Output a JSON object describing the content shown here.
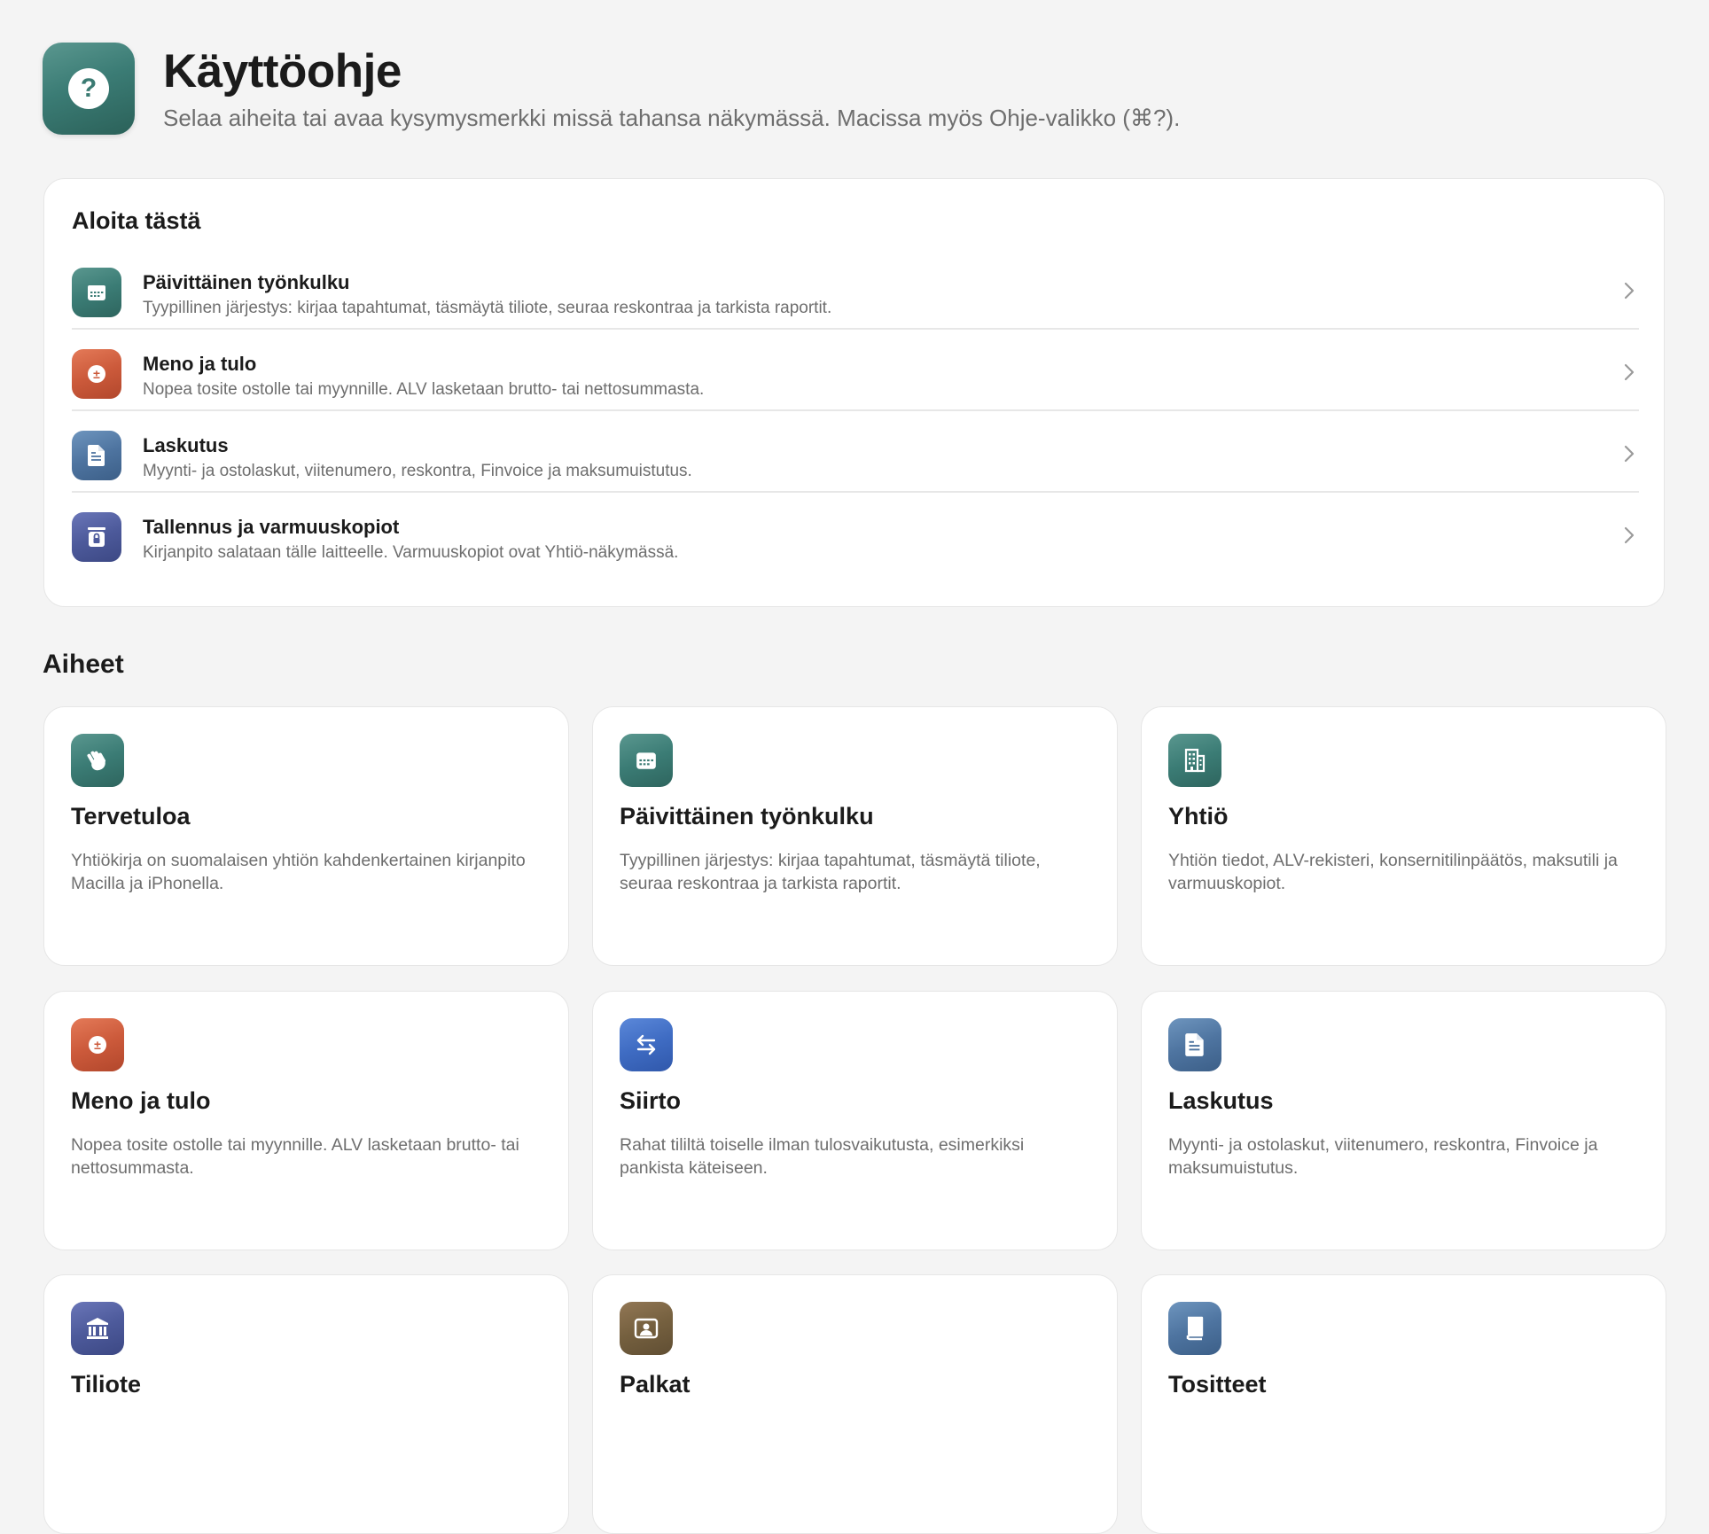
{
  "header": {
    "title": "Käyttöohje",
    "subtitle": "Selaa aiheita tai avaa kysymysmerkki missä tahansa näkymässä. Macissa myös Ohje-valikko (⌘?).",
    "icon": "question-circle-icon",
    "accent": "#3b7c75"
  },
  "start": {
    "title": "Aloita tästä",
    "items": [
      {
        "title": "Päivittäinen työnkulku",
        "description": "Tyypillinen järjestys: kirjaa tapahtumat, täsmäytä tiliote, seuraa reskontraa ja tarkista raportit.",
        "icon": "calendar-icon",
        "color": "#3b7c75"
      },
      {
        "title": "Meno ja tulo",
        "description": "Nopea tosite ostolle tai myynnille. ALV lasketaan brutto- tai nettosummasta.",
        "icon": "plus-minus-icon",
        "color": "#cc5a3b"
      },
      {
        "title": "Laskutus",
        "description": "Myynti- ja ostolaskut, viitenumero, reskontra, Finvoice ja maksumuistutus.",
        "icon": "document-icon",
        "color": "#4e74a0"
      },
      {
        "title": "Tallennus ja varmuuskopiot",
        "description": "Kirjanpito salataan tälle laitteelle. Varmuuskopiot ovat Yhtiö-näkymässä.",
        "icon": "lock-archive-icon",
        "color": "#4d5a9b"
      }
    ]
  },
  "topics": {
    "heading": "Aiheet",
    "cards": [
      {
        "title": "Tervetuloa",
        "description": "Yhtiökirja on suomalaisen yhtiön kahdenkertainen kirjanpito Macilla ja iPhonella.",
        "icon": "waving-hand-icon",
        "color": "#3b7c75"
      },
      {
        "title": "Päivittäinen työnkulku",
        "description": "Tyypillinen järjestys: kirjaa tapahtumat, täsmäytä tiliote, seuraa reskontraa ja tarkista raportit.",
        "icon": "calendar-icon",
        "color": "#3b7c75"
      },
      {
        "title": "Yhtiö",
        "description": "Yhtiön tiedot, ALV-rekisteri, konsernitilinpäätös, maksutili ja varmuuskopiot.",
        "icon": "building-icon",
        "color": "#3b7c75"
      },
      {
        "title": "Meno ja tulo",
        "description": "Nopea tosite ostolle tai myynnille. ALV lasketaan brutto- tai nettosummasta.",
        "icon": "plus-minus-icon",
        "color": "#cc5a3b"
      },
      {
        "title": "Siirto",
        "description": "Rahat tililtä toiselle ilman tulosvaikutusta, esimerkiksi pankista käteiseen.",
        "icon": "transfer-arrows-icon",
        "color": "#3f6cc3"
      },
      {
        "title": "Laskutus",
        "description": "Myynti- ja ostolaskut, viitenumero, reskontra, Finvoice ja maksumuistutus.",
        "icon": "document-icon",
        "color": "#4e74a0"
      },
      {
        "title": "Tiliote",
        "description": "",
        "icon": "bank-icon",
        "color": "#4d5a9b"
      },
      {
        "title": "Palkat",
        "description": "",
        "icon": "person-card-icon",
        "color": "#75603f"
      },
      {
        "title": "Tositteet",
        "description": "",
        "icon": "book-icon",
        "color": "#4e74a0"
      }
    ]
  }
}
